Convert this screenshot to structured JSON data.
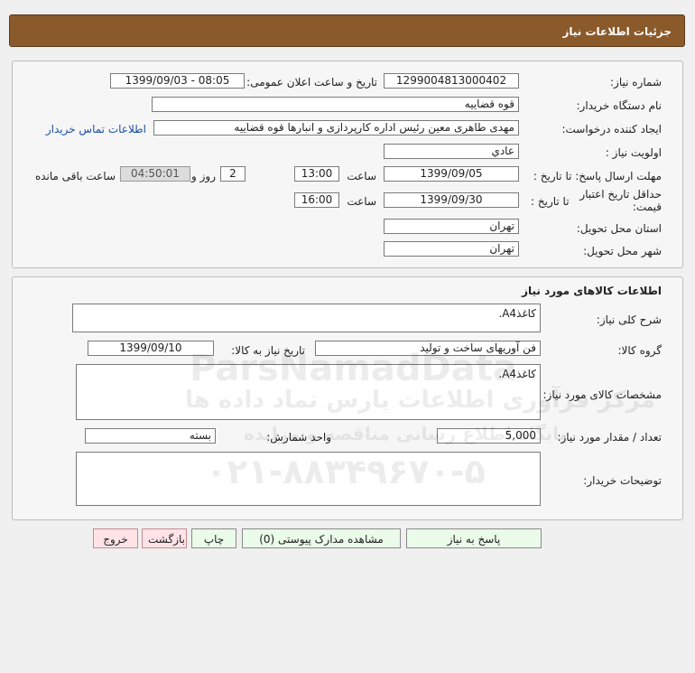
{
  "header": {
    "title": "جزئیات اطلاعات نیاز"
  },
  "need_info": {
    "need_number_label": "شماره نیاز:",
    "need_number": "1299004813000402",
    "announce_label": "تاریخ و ساعت اعلان عمومی:",
    "announce_value": "1399/09/03 - 08:05",
    "buyer_org_label": "نام دستگاه خریدار:",
    "buyer_org": "قوه قضاییه",
    "requester_label": "ایجاد کننده درخواست:",
    "requester": "مهدی طاهری معین رئیس اداره کارپردازی و انبارها قوه قضاییه",
    "contact_link": "اطلاعات تماس خریدار",
    "priority_label": "اولویت نیاز :",
    "priority": "عادي",
    "reply_deadline_label": "مهلت ارسال پاسخ: تا تاریخ :",
    "reply_date": "1399/09/05",
    "time_label": "ساعت",
    "reply_time": "13:00",
    "days_value": "2",
    "days_suffix": "روز و",
    "countdown": "04:50:01",
    "remaining_label": "ساعت باقی مانده",
    "price_validity_label": "حداقل تاریخ اعتبار قیمت:",
    "until_date_label": "تا تاریخ :",
    "validity_date": "1399/09/30",
    "validity_time": "16:00",
    "province_label": "استان محل تحویل:",
    "province": "تهران",
    "city_label": "شهر محل تحویل:",
    "city": "تهران"
  },
  "goods": {
    "section_title": "اطلاعات کالاهای مورد نیاز",
    "summary_label": "شرح کلی نیاز:",
    "summary": "کاغذA4.",
    "group_label": "گروه کالا:",
    "group": "فن آوریهای ساخت و تولید",
    "need_date_label": "تاریخ نیاز به کالا:",
    "need_date": "1399/09/10",
    "specs_label": "مشخصات کالای مورد نیاز:",
    "specs": "کاغذA4.",
    "quantity_label": "تعداد / مقدار مورد نیاز:",
    "quantity": "5,000",
    "unit_label": "واحد شمارش:",
    "unit": "بسته",
    "buyer_notes_label": "توضیحات خریدار:",
    "buyer_notes": ""
  },
  "buttons": {
    "reply": "پاسخ به نیاز",
    "attachments": "مشاهده مدارک پیوستی (0)",
    "print": "چاپ",
    "back": "بازگشت",
    "exit": "خروج"
  },
  "watermark": {
    "brand": "ParsNamadData",
    "line1": "مرکز فرآوری اطلاعات پارس نماد داده ها",
    "line2": "پایگاه اطلاع رسانی مناقصه و مزایده",
    "phone": "۰۲۱-۸۸۳۴۹۶۷۰-۵"
  }
}
